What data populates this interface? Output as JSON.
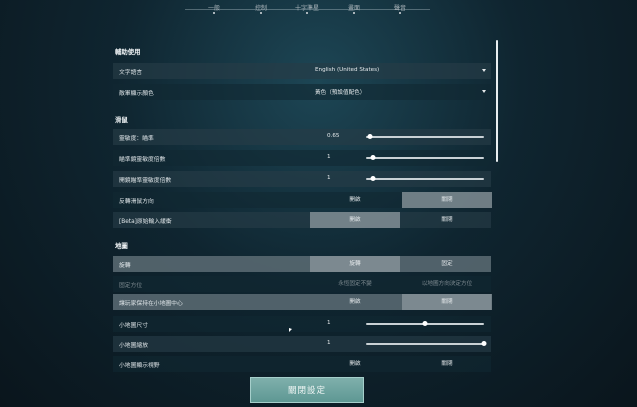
{
  "nav": {
    "tabs": [
      "一般",
      "控制",
      "十字準星",
      "畫面",
      "聲音"
    ]
  },
  "sections": {
    "accessibility": "輔助使用",
    "mouse": "滑鼠",
    "map": "地圖"
  },
  "rows": {
    "text_language": {
      "label": "文字語言",
      "value": "English (United States)"
    },
    "enemy_highlight": {
      "label": "敵軍顯示顏色",
      "value": "黃色（預設值配色）"
    },
    "sensitivity": {
      "label": "靈敏度：瞄準",
      "value": "0.65",
      "fraction": 0.03
    },
    "scoped_sensitivity": {
      "label": "瞄準鏡靈敏度倍數",
      "value": "1",
      "fraction": 0.06
    },
    "ads_sensitivity": {
      "label": "開鏡瞄準靈敏度倍數",
      "value": "1",
      "fraction": 0.06
    },
    "invert_mouse": {
      "label": "反轉滑鼠方向",
      "opt_a": "開啟",
      "opt_b": "關閉",
      "selected": "b"
    },
    "raw_input": {
      "label": "[Beta]原始輸入緩衝",
      "opt_a": "開啟",
      "opt_b": "關閉",
      "selected": "a"
    },
    "rotate": {
      "label": "旋轉",
      "opt_a": "旋轉",
      "opt_b": "固定",
      "selected": "a"
    },
    "fixed_orientation": {
      "label": "固定方位",
      "opt_a": "永恆固定不變",
      "opt_b": "以地圖方向決定方位"
    },
    "keep_player_centered": {
      "label": "讓玩家保持在小地圖中心",
      "opt_a": "開啟",
      "opt_b": "關閉",
      "selected": "b"
    },
    "minimap_size": {
      "label": "小地圖尺寸",
      "value": "1",
      "fraction": 0.5
    },
    "minimap_zoom": {
      "label": "小地圖縮放",
      "value": "1",
      "fraction": 1.0
    },
    "minimap_vision": {
      "label": "小地圖顯示視野",
      "opt_a": "開啟",
      "opt_b": "關閉"
    }
  },
  "footer": {
    "close_label": "關閉設定"
  }
}
